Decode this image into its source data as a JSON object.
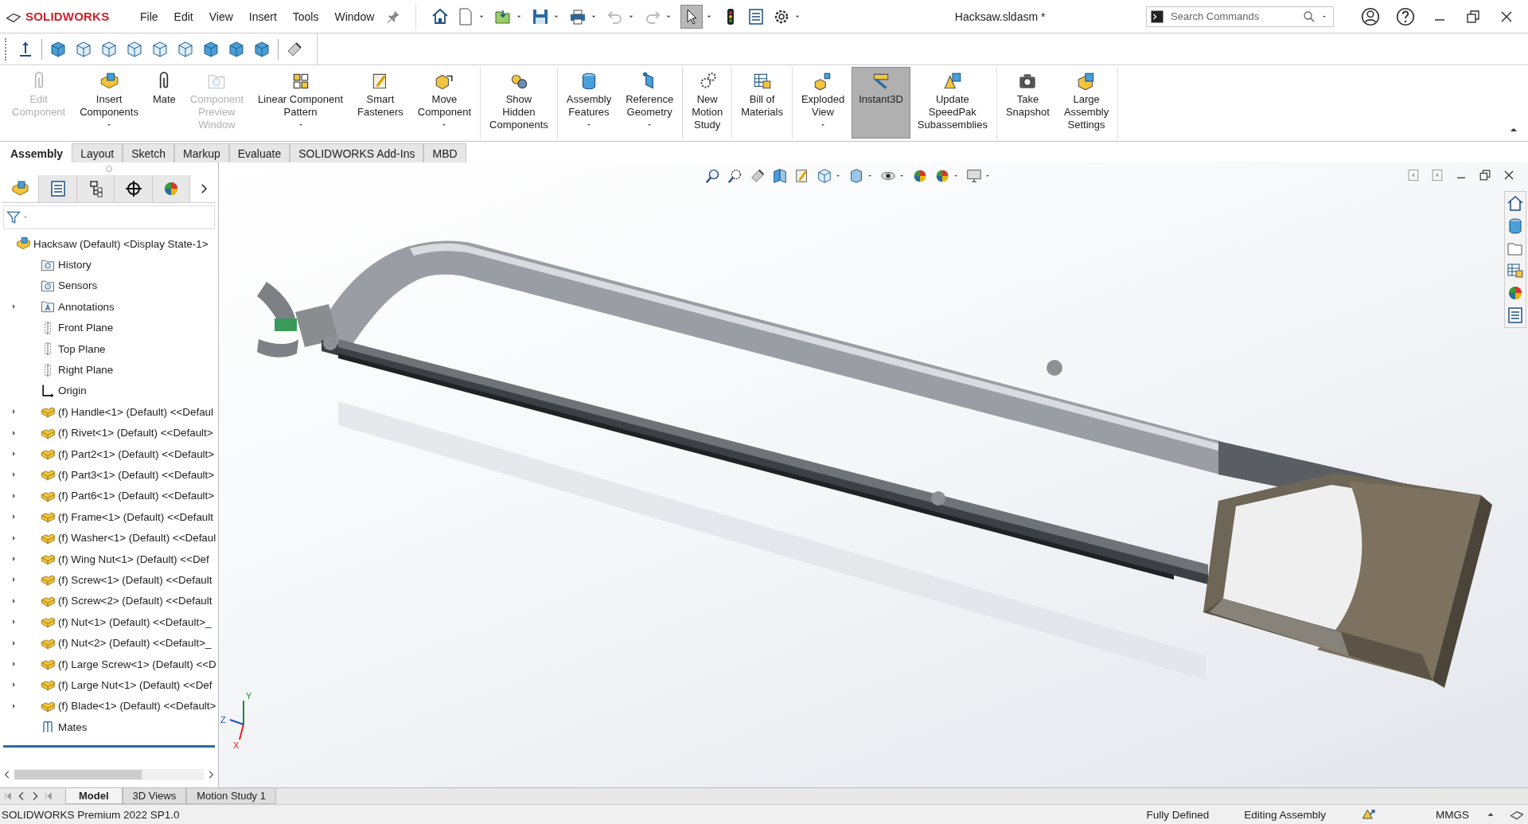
{
  "app": {
    "logo": "SOLIDWORKS"
  },
  "menu": [
    "File",
    "Edit",
    "View",
    "Insert",
    "Tools",
    "Window"
  ],
  "window": {
    "title": "Hacksaw.sldasm *"
  },
  "search": {
    "placeholder": "Search Commands"
  },
  "ribbon": {
    "groups": [
      {
        "items": [
          {
            "label": "Edit\nComponent",
            "disabled": true,
            "dropdown": false,
            "selected": false
          },
          {
            "label": "Insert\nComponents",
            "disabled": false,
            "dropdown": true,
            "selected": false
          },
          {
            "label": "Mate",
            "disabled": false,
            "dropdown": false,
            "selected": false
          },
          {
            "label": "Component\nPreview\nWindow",
            "disabled": true,
            "dropdown": false,
            "selected": false
          },
          {
            "label": "Linear Component\nPattern",
            "disabled": false,
            "dropdown": true,
            "selected": false
          },
          {
            "label": "Smart\nFasteners",
            "disabled": false,
            "dropdown": false,
            "selected": false
          },
          {
            "label": "Move\nComponent",
            "disabled": false,
            "dropdown": true,
            "selected": false
          }
        ]
      },
      {
        "items": [
          {
            "label": "Show\nHidden\nComponents",
            "disabled": false,
            "dropdown": false,
            "selected": false
          }
        ]
      },
      {
        "items": [
          {
            "label": "Assembly\nFeatures",
            "disabled": false,
            "dropdown": true,
            "selected": false
          },
          {
            "label": "Reference\nGeometry",
            "disabled": false,
            "dropdown": true,
            "selected": false
          }
        ]
      },
      {
        "items": [
          {
            "label": "New\nMotion\nStudy",
            "disabled": false,
            "dropdown": false,
            "selected": false
          }
        ]
      },
      {
        "items": [
          {
            "label": "Bill of\nMaterials",
            "disabled": false,
            "dropdown": false,
            "selected": false
          }
        ]
      },
      {
        "items": [
          {
            "label": "Exploded\nView",
            "disabled": false,
            "dropdown": true,
            "selected": false
          },
          {
            "label": "Instant3D",
            "disabled": false,
            "dropdown": false,
            "selected": true
          },
          {
            "label": "Update\nSpeedPak\nSubassemblies",
            "disabled": false,
            "dropdown": false,
            "selected": false
          }
        ]
      },
      {
        "items": [
          {
            "label": "Take\nSnapshot",
            "disabled": false,
            "dropdown": false,
            "selected": false
          },
          {
            "label": "Large\nAssembly\nSettings",
            "disabled": false,
            "dropdown": false,
            "selected": false
          }
        ]
      }
    ]
  },
  "command_tabs": [
    {
      "label": "Assembly",
      "selected": true
    },
    {
      "label": "Layout",
      "selected": false
    },
    {
      "label": "Sketch",
      "selected": false
    },
    {
      "label": "Markup",
      "selected": false
    },
    {
      "label": "Evaluate",
      "selected": false
    },
    {
      "label": "SOLIDWORKS Add-Ins",
      "selected": false
    },
    {
      "label": "MBD",
      "selected": false
    }
  ],
  "feature_tree": {
    "panel_tabs": [
      {
        "selected": true
      },
      {
        "selected": false
      },
      {
        "selected": false
      },
      {
        "selected": false
      },
      {
        "selected": false
      }
    ],
    "items": [
      {
        "kind": "assembly",
        "label": "Hacksaw (Default) <Display State-1>",
        "expander": false
      },
      {
        "kind": "history",
        "label": "History",
        "expander": false
      },
      {
        "kind": "sensors",
        "label": "Sensors",
        "expander": false
      },
      {
        "kind": "annotations",
        "label": "Annotations",
        "expander": true
      },
      {
        "kind": "plane",
        "label": "Front Plane",
        "expander": false
      },
      {
        "kind": "plane",
        "label": "Top Plane",
        "expander": false
      },
      {
        "kind": "plane",
        "label": "Right Plane",
        "expander": false
      },
      {
        "kind": "origin",
        "label": "Origin",
        "expander": false
      },
      {
        "kind": "part",
        "label": "(f) Handle<1> (Default) <<Defaul",
        "expander": true
      },
      {
        "kind": "part",
        "label": "(f) Rivet<1> (Default) <<Default>",
        "expander": true
      },
      {
        "kind": "part",
        "label": "(f) Part2<1> (Default) <<Default>",
        "expander": true
      },
      {
        "kind": "part",
        "label": "(f) Part3<1> (Default) <<Default>",
        "expander": true
      },
      {
        "kind": "part",
        "label": "(f) Part6<1> (Default) <<Default>",
        "expander": true
      },
      {
        "kind": "part",
        "label": "(f) Frame<1> (Default) <<Default",
        "expander": true
      },
      {
        "kind": "part",
        "label": "(f) Washer<1> (Default) <<Defaul",
        "expander": true
      },
      {
        "kind": "part",
        "label": "(f) Wing Nut<1> (Default) <<Def",
        "expander": true
      },
      {
        "kind": "part",
        "label": "(f) Screw<1> (Default) <<Default",
        "expander": true
      },
      {
        "kind": "part",
        "label": "(f) Screw<2> (Default) <<Default",
        "expander": true
      },
      {
        "kind": "part",
        "label": "(f) Nut<1> (Default) <<Default>_",
        "expander": true
      },
      {
        "kind": "part",
        "label": "(f) Nut<2> (Default) <<Default>_",
        "expander": true
      },
      {
        "kind": "part",
        "label": "(f) Large Screw<1> (Default) <<D",
        "expander": true
      },
      {
        "kind": "part",
        "label": "(f) Large Nut<1> (Default) <<Def",
        "expander": true
      },
      {
        "kind": "part",
        "label": "(f) Blade<1> (Default) <<Default>",
        "expander": true
      },
      {
        "kind": "mates",
        "label": "Mates",
        "expander": false
      }
    ]
  },
  "triad": {
    "x": "X",
    "y": "Y",
    "z": "Z"
  },
  "bottom_tabs": [
    {
      "label": "Model",
      "selected": true
    },
    {
      "label": "3D Views",
      "selected": false
    },
    {
      "label": "Motion Study 1",
      "selected": false
    }
  ],
  "status_bar": {
    "version": "SOLIDWORKS Premium 2022 SP1.0",
    "state": "Fully Defined",
    "mode": "Editing Assembly",
    "units": "MMGS"
  }
}
